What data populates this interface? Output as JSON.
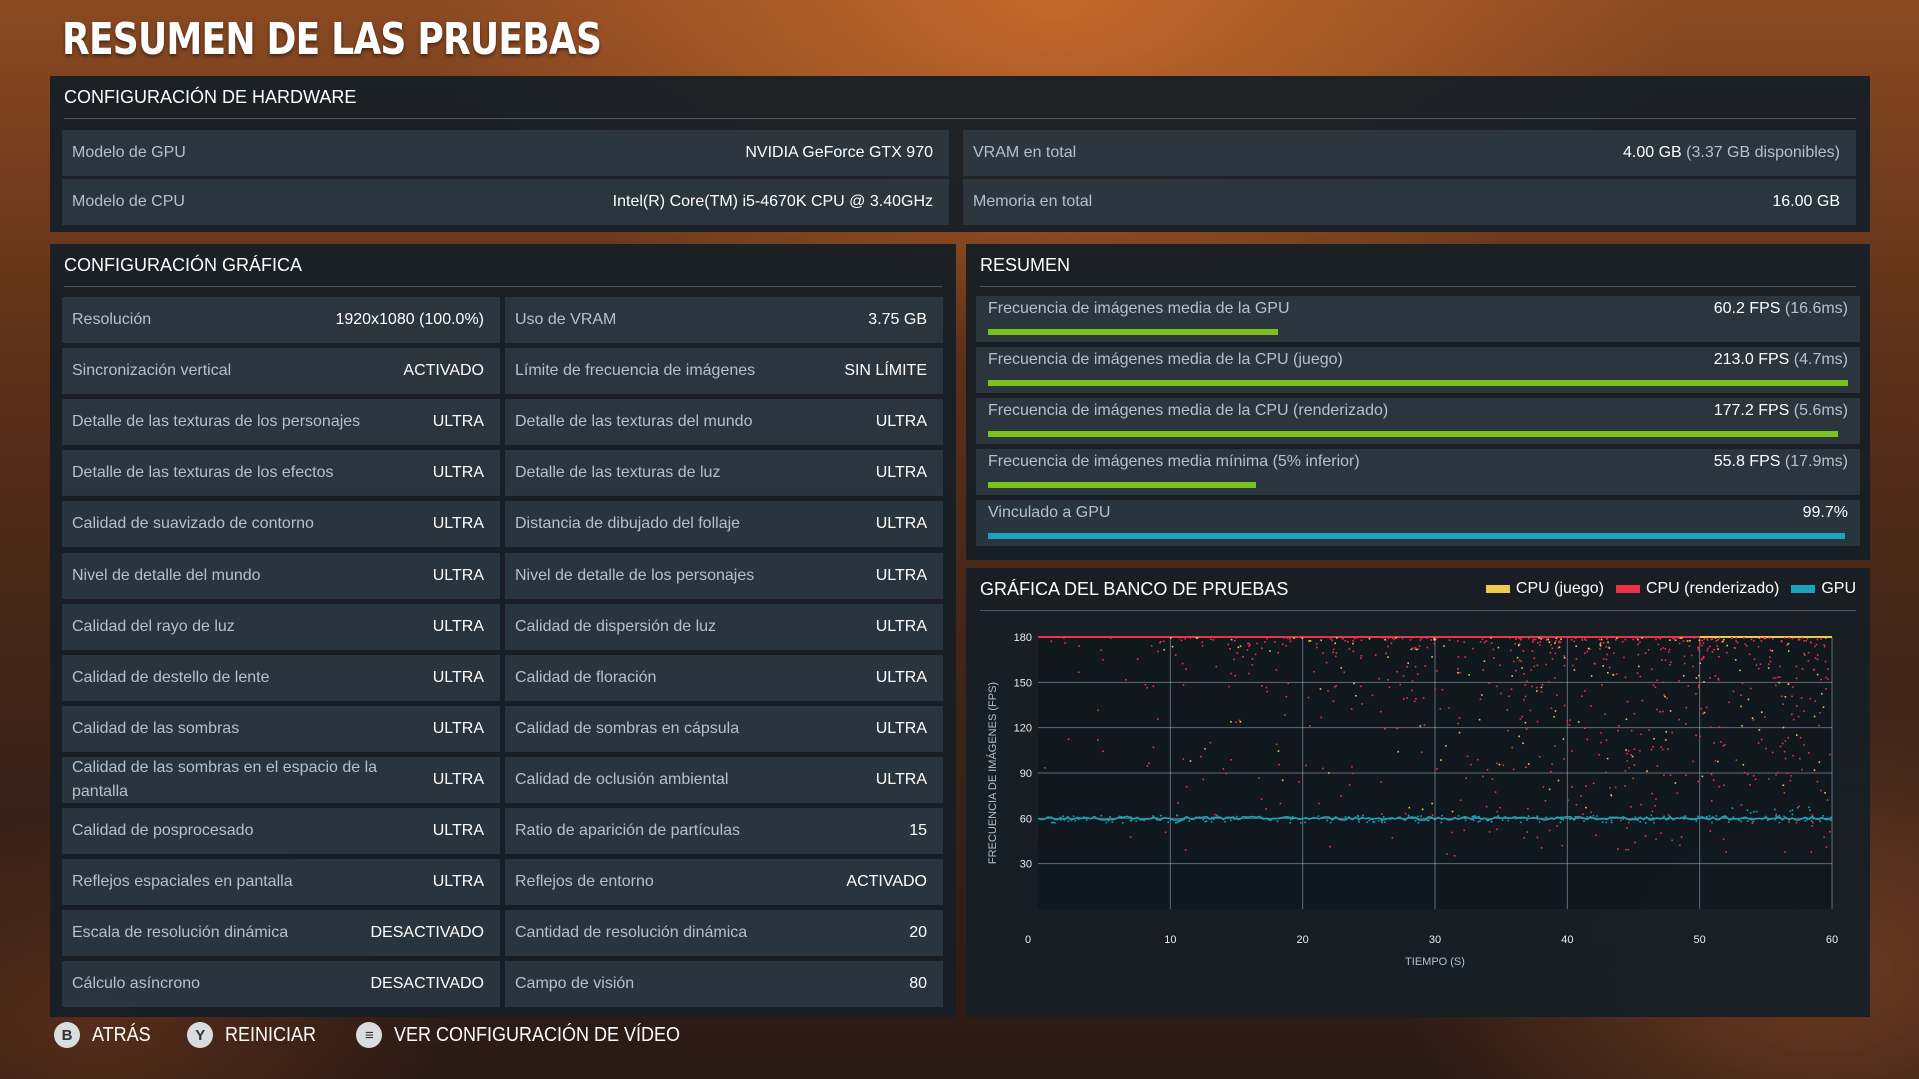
{
  "page": {
    "title": "RESUMEN DE LAS PRUEBAS"
  },
  "hardware": {
    "title": "CONFIGURACIÓN DE HARDWARE",
    "gpu_label": "Modelo de GPU",
    "gpu_value": "NVIDIA GeForce GTX 970",
    "cpu_label": "Modelo de CPU",
    "cpu_value": "Intel(R) Core(TM) i5-4670K CPU @ 3.40GHz",
    "vram_label": "VRAM en total",
    "vram_value": "4.00 GB",
    "vram_sub": "(3.37 GB disponibles)",
    "mem_label": "Memoria en total",
    "mem_value": "16.00 GB"
  },
  "graphics": {
    "title": "CONFIGURACIÓN GRÁFICA",
    "left": [
      {
        "label": "Resolución",
        "value": "1920x1080 (100.0%)"
      },
      {
        "label": "Sincronización vertical",
        "value": "ACTIVADO"
      },
      {
        "label": "Detalle de las texturas de los personajes",
        "value": "ULTRA"
      },
      {
        "label": "Detalle de las texturas de los efectos",
        "value": "ULTRA"
      },
      {
        "label": "Calidad de suavizado de contorno",
        "value": "ULTRA"
      },
      {
        "label": "Nivel de detalle del mundo",
        "value": "ULTRA"
      },
      {
        "label": "Calidad del rayo de luz",
        "value": "ULTRA"
      },
      {
        "label": "Calidad de destello de lente",
        "value": "ULTRA"
      },
      {
        "label": "Calidad de las sombras",
        "value": "ULTRA"
      },
      {
        "label": "Calidad de las sombras en el espacio de la pantalla",
        "value": "ULTRA"
      },
      {
        "label": "Calidad de posprocesado",
        "value": "ULTRA"
      },
      {
        "label": "Reflejos espaciales en pantalla",
        "value": "ULTRA"
      },
      {
        "label": "Escala de resolución dinámica",
        "value": "DESACTIVADO"
      },
      {
        "label": "Cálculo asíncrono",
        "value": "DESACTIVADO"
      }
    ],
    "right": [
      {
        "label": "Uso de VRAM",
        "value": "3.75 GB"
      },
      {
        "label": "Límite de frecuencia de imágenes",
        "value": "SIN LÍMITE"
      },
      {
        "label": "Detalle de las texturas del mundo",
        "value": "ULTRA"
      },
      {
        "label": "Detalle de las texturas de luz",
        "value": "ULTRA"
      },
      {
        "label": "Distancia de dibujado del follaje",
        "value": "ULTRA"
      },
      {
        "label": "Nivel de detalle de los personajes",
        "value": "ULTRA"
      },
      {
        "label": "Calidad de dispersión de luz",
        "value": "ULTRA"
      },
      {
        "label": "Calidad de floración",
        "value": "ULTRA"
      },
      {
        "label": "Calidad de sombras en cápsula",
        "value": "ULTRA"
      },
      {
        "label": "Calidad de oclusión ambiental",
        "value": "ULTRA"
      },
      {
        "label": "Ratio de aparición de partículas",
        "value": "15"
      },
      {
        "label": "Reflejos de entorno",
        "value": "ACTIVADO"
      },
      {
        "label": "Cantidad de resolución dinámica",
        "value": "20"
      },
      {
        "label": "Campo de visión",
        "value": "80"
      }
    ]
  },
  "summary": {
    "title": "RESUMEN",
    "rows": [
      {
        "label": "Frecuencia de imágenes media de la GPU",
        "value": "60.2 FPS",
        "sub": "(16.6ms)",
        "fraction": 0.337,
        "color": "#7cc21f"
      },
      {
        "label": "Frecuencia de imágenes media de la CPU (juego)",
        "value": "213.0 FPS",
        "sub": "(4.7ms)",
        "fraction": 1.0,
        "color": "#7cc21f"
      },
      {
        "label": "Frecuencia de imágenes media de la CPU (renderizado)",
        "value": "177.2 FPS",
        "sub": "(5.6ms)",
        "fraction": 0.988,
        "color": "#7cc21f"
      },
      {
        "label": "Frecuencia de imágenes media mínima (5% inferior)",
        "value": "55.8 FPS",
        "sub": "(17.9ms)",
        "fraction": 0.312,
        "color": "#7cc21f"
      },
      {
        "label": "Vinculado a GPU",
        "value": "99.7%",
        "sub": "",
        "fraction": 0.997,
        "color": "#1aa3bf"
      }
    ]
  },
  "chart_data": {
    "type": "scatter",
    "title": "GRÁFICA DEL BANCO DE PRUEBAS",
    "xlabel": "TIEMPO (S)",
    "ylabel": "FRECUENCIA DE IMÁGENES (FPS)",
    "xlim": [
      0,
      60
    ],
    "ylim": [
      0,
      180
    ],
    "x_ticks": [
      0,
      10,
      20,
      30,
      40,
      50,
      60
    ],
    "y_ticks": [
      30,
      60,
      90,
      120,
      150,
      180
    ],
    "grid": true,
    "legend_position": "top-right",
    "series": [
      {
        "name": "CPU (juego)",
        "color": "#f2c94c",
        "description_values": {
          "typical": 180,
          "min": 60,
          "max": 180
        }
      },
      {
        "name": "CPU (renderizado)",
        "color": "#e8334a",
        "description_values": {
          "typical": 180,
          "min": 35,
          "max": 180
        }
      },
      {
        "name": "GPU",
        "color": "#1aa3bf",
        "description_values": {
          "typical": 60,
          "min": 55,
          "max": 68
        }
      }
    ]
  },
  "footer": {
    "back": {
      "glyph": "B",
      "label": "ATRÁS"
    },
    "restart": {
      "glyph": "Y",
      "label": "REINICIAR"
    },
    "video": {
      "glyph": "≡",
      "label": "VER CONFIGURACIÓN DE VÍDEO"
    }
  }
}
